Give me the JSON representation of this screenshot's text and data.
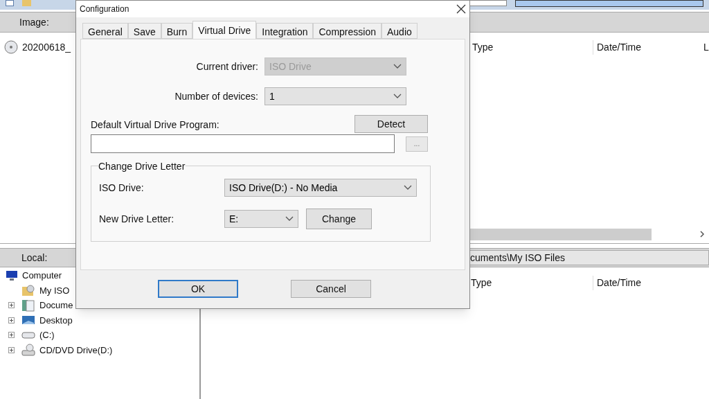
{
  "image_bar": {
    "label": "Image:"
  },
  "image_list": {
    "item": "20200618_",
    "columns": [
      "Type",
      "Date/Time",
      "L"
    ]
  },
  "local_bar": {
    "label": "Local:",
    "path": "cuments\\My ISO Files"
  },
  "tree": [
    {
      "label": "Computer",
      "kind": "computer",
      "expandable": false,
      "children": [
        {
          "label": "My ISO",
          "kind": "iso-folder",
          "expandable": false
        },
        {
          "label": "Docume",
          "kind": "documents",
          "expandable": true
        },
        {
          "label": "Desktop",
          "kind": "desktop",
          "expandable": true
        },
        {
          "label": "(C:)",
          "kind": "drive",
          "expandable": true
        },
        {
          "label": "CD/DVD Drive(D:)",
          "kind": "cd-drive",
          "expandable": true
        }
      ]
    }
  ],
  "local_list": {
    "columns": [
      "Type",
      "Date/Time"
    ]
  },
  "dialog": {
    "title": "Configuration",
    "tabs": [
      {
        "label": "General",
        "selected": false
      },
      {
        "label": "Save",
        "selected": false
      },
      {
        "label": "Burn",
        "selected": false
      },
      {
        "label": "Virtual Drive",
        "selected": true
      },
      {
        "label": "Integration",
        "selected": false
      },
      {
        "label": "Compression",
        "selected": false
      },
      {
        "label": "Audio",
        "selected": false
      }
    ],
    "current_driver": {
      "label": "Current driver:",
      "value": "ISO Drive",
      "disabled": true
    },
    "number_of_devices": {
      "label": "Number of devices:",
      "value": "1",
      "disabled": false
    },
    "program": {
      "label": "Default Virtual Drive Program:",
      "detect_button": "Detect",
      "browse_button": "..."
    },
    "group": {
      "title": "Change Drive Letter",
      "iso_drive": {
        "label": "ISO Drive:",
        "value": "ISO Drive(D:) - No Media",
        "disabled": false
      },
      "new_letter": {
        "label": "New Drive Letter:",
        "value": "E:",
        "disabled": false
      },
      "change_button": "Change"
    },
    "buttons": [
      {
        "label": "OK",
        "focused": true
      },
      {
        "label": "Cancel",
        "focused": false
      }
    ]
  }
}
